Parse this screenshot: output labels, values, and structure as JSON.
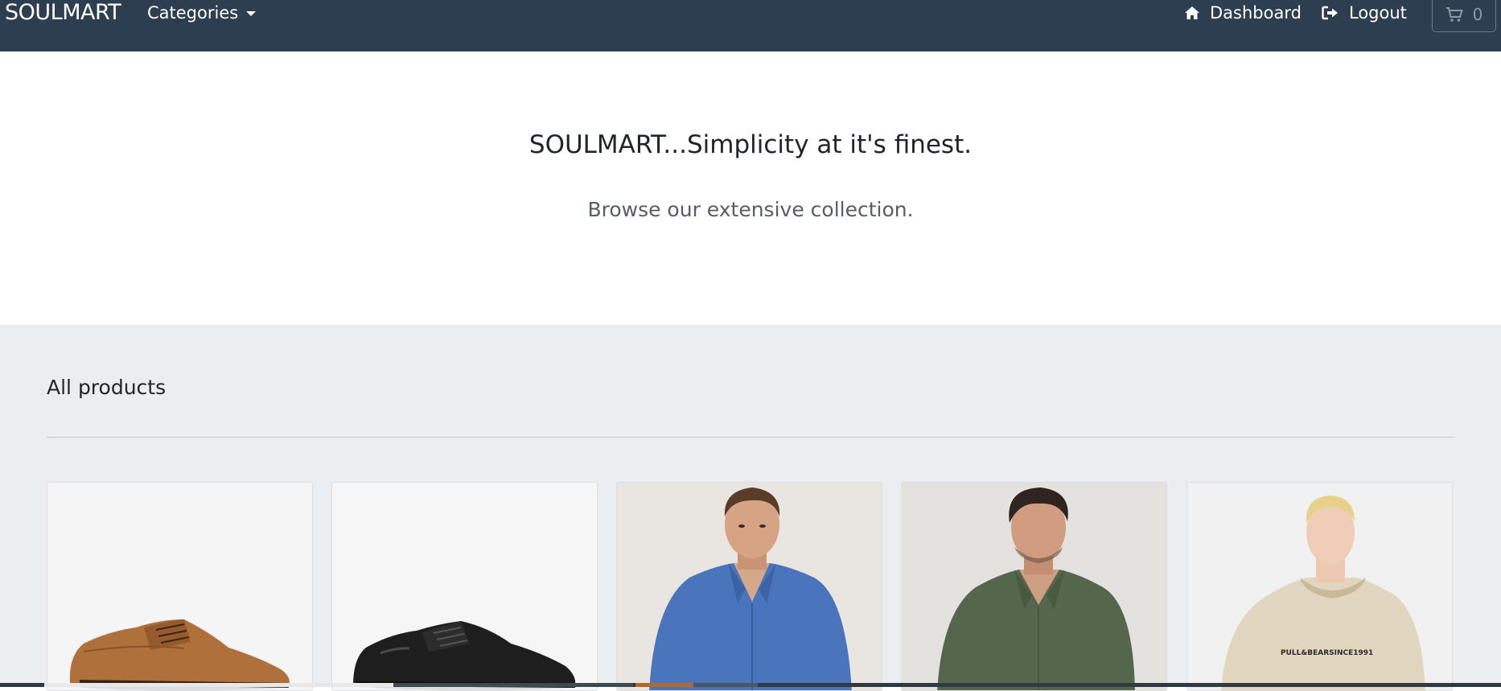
{
  "navbar": {
    "brand": "SOULMART",
    "categories_label": "Categories",
    "dashboard_label": "Dashboard",
    "logout_label": "Logout",
    "cart_count": "0",
    "background_color": "#2c3e50"
  },
  "hero": {
    "title": "SOULMART...Simplicity at it's finest.",
    "subtitle": "Browse our extensive collection."
  },
  "products_section": {
    "title": "All products",
    "background_color": "#ebeef0",
    "items": [
      {
        "image": "brown-leather-derby-shoe"
      },
      {
        "image": "black-leather-derby-shoe"
      },
      {
        "image": "man-in-blue-linen-shirt"
      },
      {
        "image": "man-in-green-linen-shirt"
      },
      {
        "image": "man-in-beige-hoodie"
      }
    ],
    "hoodie_print": "PULL&BEARSINCE1991"
  }
}
